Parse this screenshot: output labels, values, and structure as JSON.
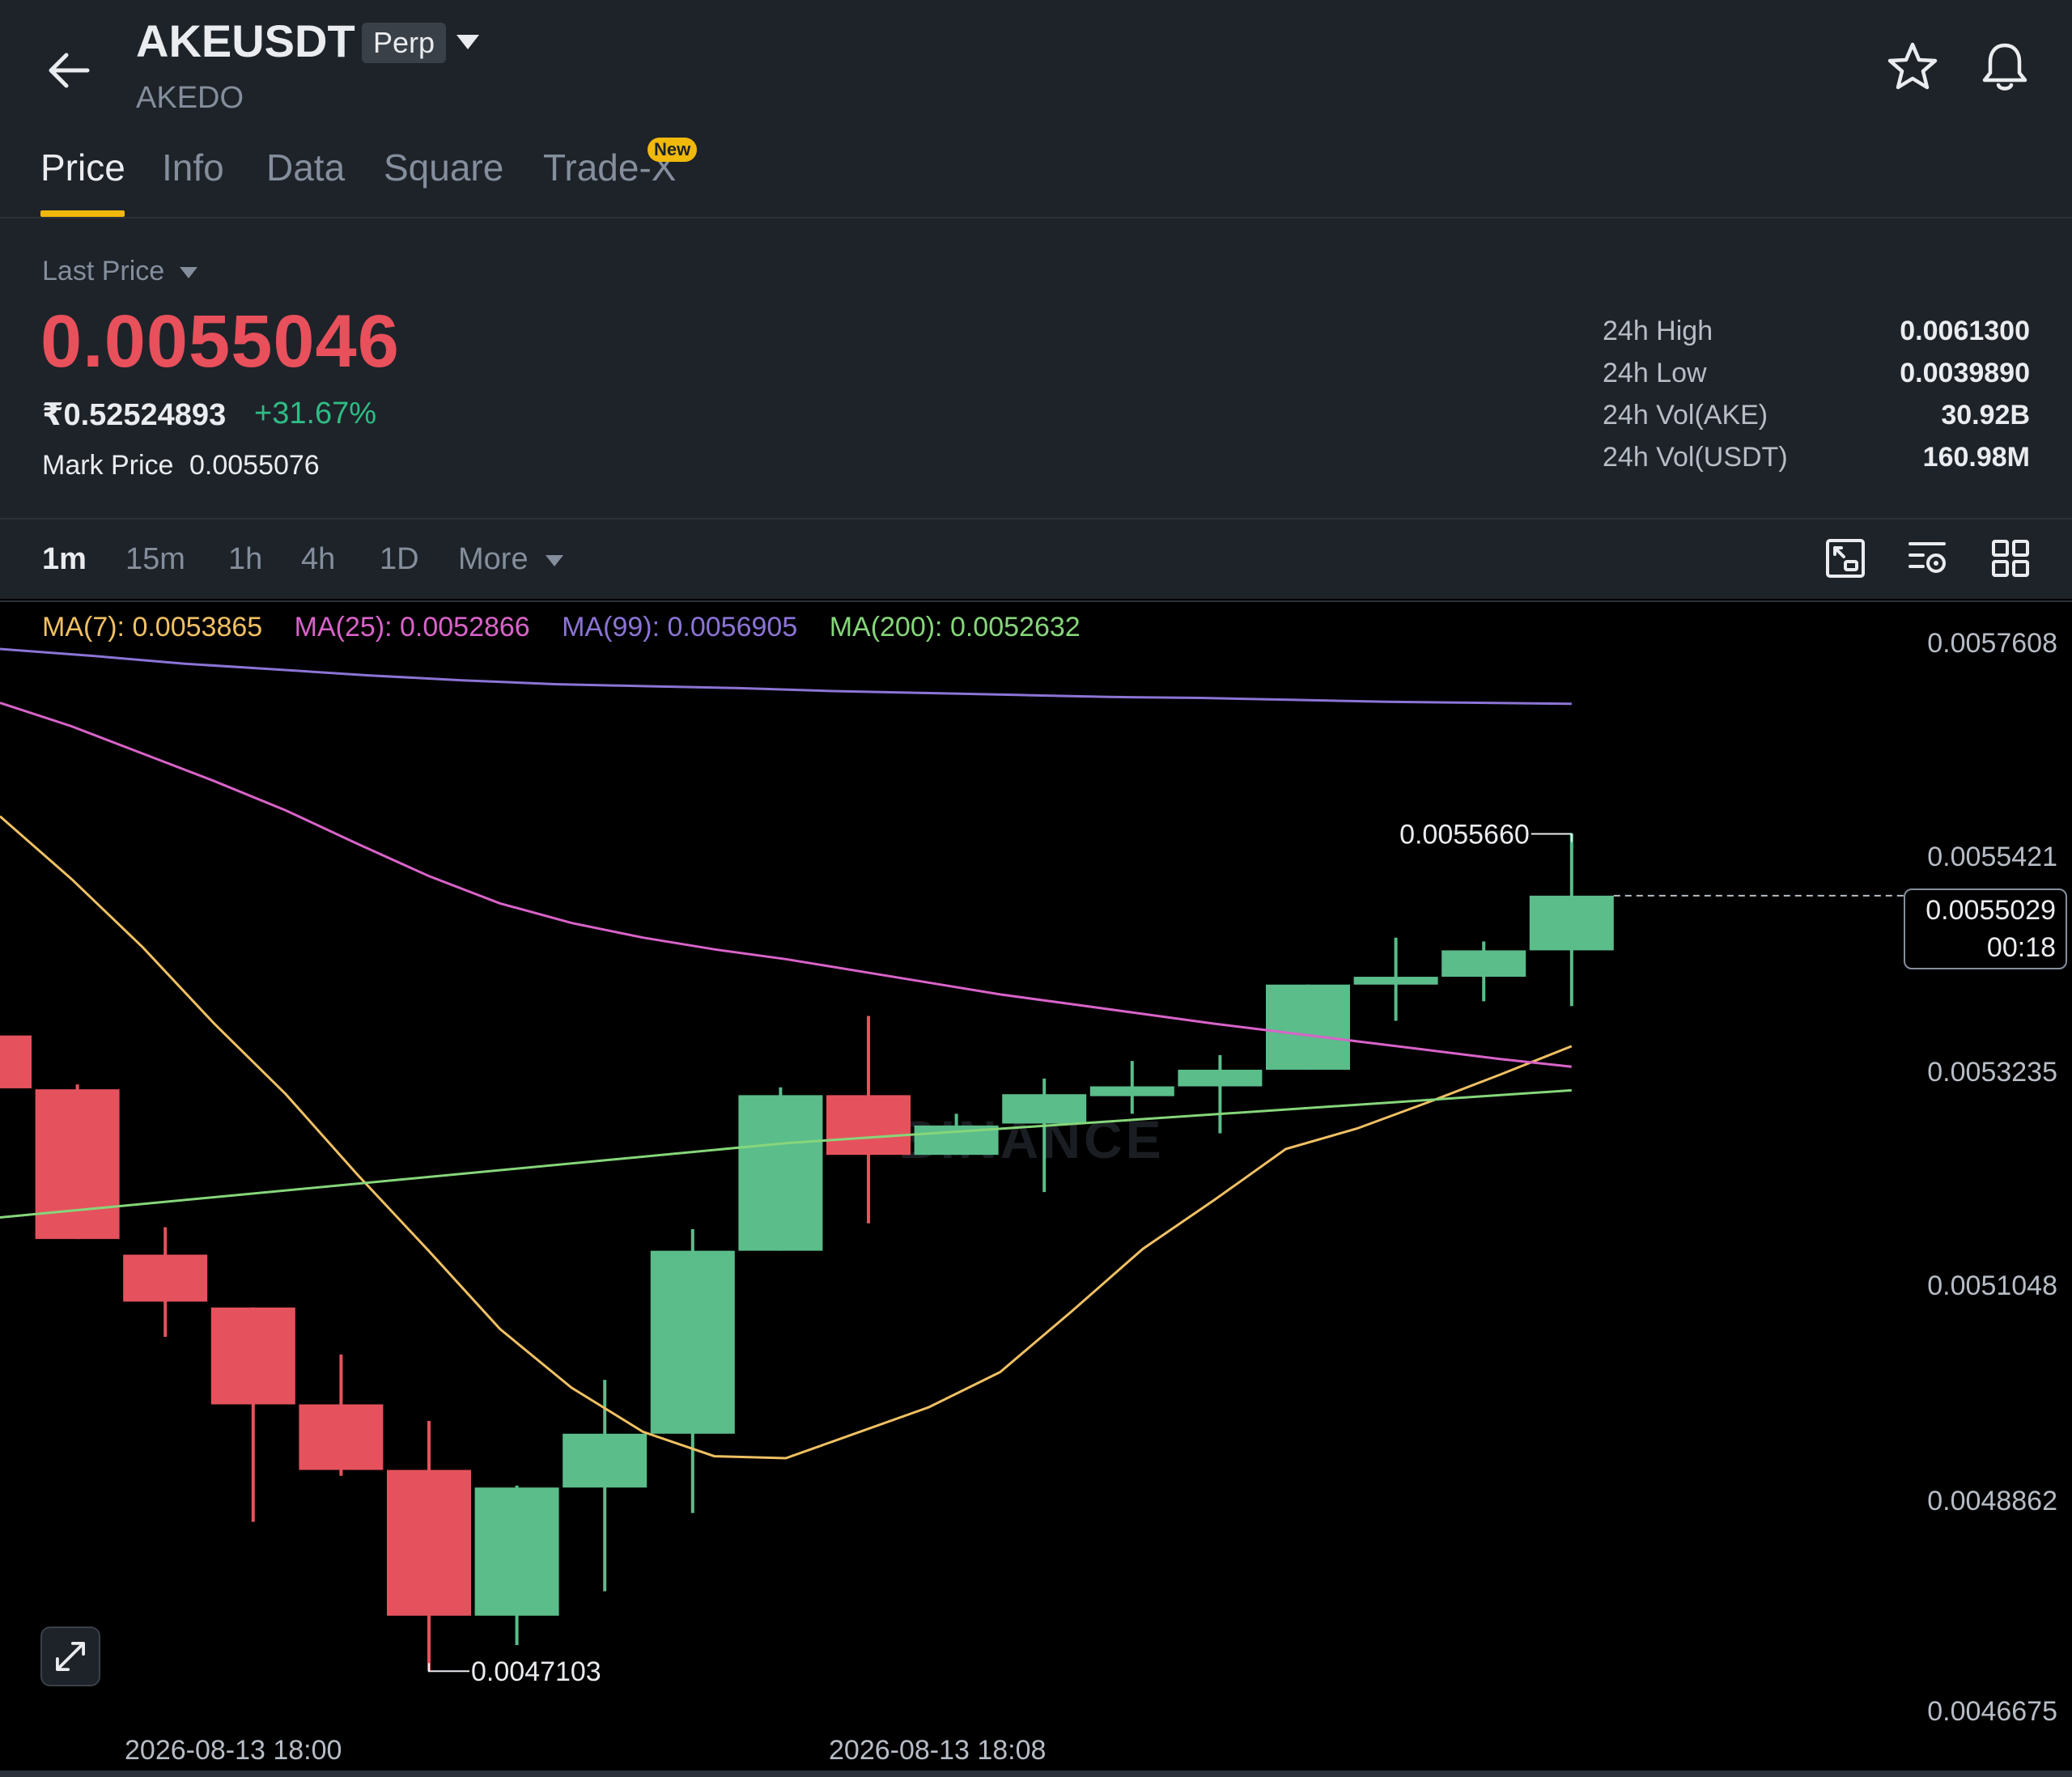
{
  "header": {
    "symbol": "AKEUSDT",
    "contract_type": "Perp",
    "name": "AKEDO"
  },
  "tabs": [
    {
      "label": "Price",
      "active": true
    },
    {
      "label": "Info"
    },
    {
      "label": "Data"
    },
    {
      "label": "Square"
    },
    {
      "label": "Trade-X",
      "badge": "New"
    }
  ],
  "price": {
    "last_price_label": "Last Price",
    "last_price": "0.0055046",
    "inr_price": "₹0.52524893",
    "change_pct": "+31.67%",
    "mark_price_label": "Mark Price",
    "mark_price": "0.0055076"
  },
  "stats": [
    {
      "label": "24h High",
      "value": "0.0061300"
    },
    {
      "label": "24h Low",
      "value": "0.0039890"
    },
    {
      "label": "24h Vol(AKE)",
      "value": "30.92B"
    },
    {
      "label": "24h Vol(USDT)",
      "value": "160.98M"
    }
  ],
  "intervals": [
    {
      "label": "1m",
      "active": true
    },
    {
      "label": "15m"
    },
    {
      "label": "1h"
    },
    {
      "label": "4h"
    },
    {
      "label": "1D"
    },
    {
      "label": "More"
    }
  ],
  "ma": [
    {
      "label": "MA(7): 0.0053865",
      "color": "#f0c063"
    },
    {
      "label": "MA(25): 0.0052866",
      "color": "#d963c9"
    },
    {
      "label": "MA(99): 0.0056905",
      "color": "#8c74d6"
    },
    {
      "label": "MA(200): 0.0052632",
      "color": "#86d67a"
    }
  ],
  "chart": {
    "price_axis": [
      "0.0057608",
      "0.0055421",
      "0.0053235",
      "0.0051048",
      "0.0048862",
      "0.0046675"
    ],
    "current_price": "0.0055029",
    "countdown": "00:18",
    "high_marker": "0.0055660",
    "low_marker": "0.0047103",
    "time_axis": [
      "2026-08-13 18:00",
      "2026-08-13 18:08"
    ],
    "watermark": "BINANCE",
    "up_color": "#5bbd8a",
    "down_color": "#e5525d"
  },
  "chart_data": {
    "type": "candlestick",
    "interval": "1m",
    "ylim": [
      0.0046675,
      0.0057608
    ],
    "candles": [
      {
        "open": 0.00536,
        "high": 0.00538,
        "close": 0.005306,
        "low": 0.00527
      },
      {
        "open": 0.005305,
        "high": 0.00531,
        "close": 0.005152,
        "low": 0.005152
      },
      {
        "open": 0.005136,
        "high": 0.005164,
        "close": 0.005088,
        "low": 0.005052
      },
      {
        "open": 0.005082,
        "high": 0.005082,
        "close": 0.004983,
        "low": 0.004863
      },
      {
        "open": 0.004983,
        "high": 0.005034,
        "close": 0.004916,
        "low": 0.00491
      },
      {
        "open": 0.004916,
        "high": 0.004966,
        "close": 0.004767,
        "low": 0.0047103
      },
      {
        "open": 0.004767,
        "high": 0.0049,
        "close": 0.004898,
        "low": 0.004737
      },
      {
        "open": 0.004898,
        "high": 0.005008,
        "close": 0.004953,
        "low": 0.004792
      },
      {
        "open": 0.004953,
        "high": 0.005162,
        "close": 0.00514,
        "low": 0.004872
      },
      {
        "open": 0.00514,
        "high": 0.005307,
        "close": 0.005299,
        "low": 0.00514
      },
      {
        "open": 0.005299,
        "high": 0.00538,
        "close": 0.005238,
        "low": 0.005168
      },
      {
        "open": 0.005238,
        "high": 0.00528,
        "close": 0.005268,
        "low": 0.005238
      },
      {
        "open": 0.00527,
        "high": 0.005316,
        "close": 0.0053,
        "low": 0.0052
      },
      {
        "open": 0.005298,
        "high": 0.005334,
        "close": 0.005308,
        "low": 0.00528
      },
      {
        "open": 0.005308,
        "high": 0.00534,
        "close": 0.005325,
        "low": 0.00526
      },
      {
        "open": 0.005325,
        "high": 0.005412,
        "close": 0.005412,
        "low": 0.005325
      },
      {
        "open": 0.005412,
        "high": 0.00546,
        "close": 0.00542,
        "low": 0.005375
      },
      {
        "open": 0.00542,
        "high": 0.005456,
        "close": 0.005447,
        "low": 0.005395
      },
      {
        "open": 0.005447,
        "high": 0.005566,
        "close": 0.0055029,
        "low": 0.00539
      }
    ],
    "series": [
      {
        "name": "MA(7)",
        "color": "#f0c063",
        "values": [
          0.005584,
          0.00552,
          0.00545,
          0.005372,
          0.0053,
          0.005218,
          0.00514,
          0.00506,
          0.005,
          0.004955,
          0.00493,
          0.004928,
          0.004954,
          0.00498,
          0.005016,
          0.005078,
          0.005142,
          0.005192,
          0.005244,
          0.005265,
          0.005292,
          0.00532,
          0.005349
        ]
      },
      {
        "name": "MA(25)",
        "color": "#d963c9",
        "values": [
          0.0057,
          0.005676,
          0.005648,
          0.00562,
          0.00559,
          0.005556,
          0.005523,
          0.005495,
          0.005475,
          0.00546,
          0.005448,
          0.005438,
          0.005426,
          0.005414,
          0.005402,
          0.005392,
          0.005382,
          0.005372,
          0.005363,
          0.005354,
          0.005345,
          0.005336,
          0.005328
        ]
      },
      {
        "name": "MA(99)",
        "color": "#8c74d6",
        "values": [
          0.005755,
          0.005748,
          0.00574,
          0.005734,
          0.005728,
          0.005723,
          0.005719,
          0.005717,
          0.005715,
          0.005712,
          0.00571,
          0.005708,
          0.005706,
          0.005705,
          0.005703,
          0.005701,
          0.0057,
          0.005699
        ]
      },
      {
        "name": "MA(200)",
        "color": "#86d67a",
        "values": [
          0.005174,
          0.00525,
          0.005304
        ]
      }
    ]
  }
}
